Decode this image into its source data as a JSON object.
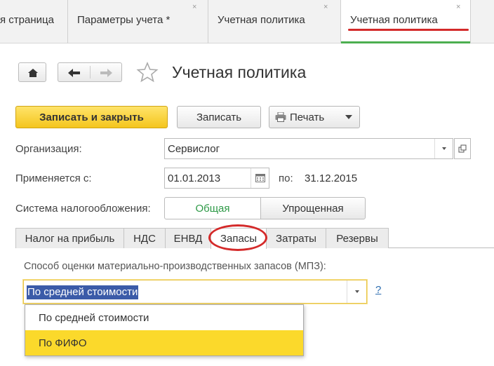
{
  "tabs": [
    {
      "label": "я страница",
      "closable": false
    },
    {
      "label": "Параметры учета *",
      "closable": true
    },
    {
      "label": "Учетная политика",
      "closable": true
    },
    {
      "label": "Учетная политика",
      "closable": true,
      "active": true
    }
  ],
  "close_glyph": "×",
  "page": {
    "title": "Учетная политика"
  },
  "toolbar": {
    "save_close": "Записать и закрыть",
    "save": "Записать",
    "print": "Печать"
  },
  "form": {
    "org_label": "Организация:",
    "org_value": "Сервислог",
    "applies_label": "Применяется с:",
    "applies_value": "01.01.2013",
    "to_label": "по:",
    "to_value": "31.12.2015",
    "tax_label": "Система налогообложения:",
    "tax_options": [
      "Общая",
      "Упрощенная"
    ],
    "tax_selected": "Общая"
  },
  "form_tabs": [
    "Налог на прибыль",
    "НДС",
    "ЕНВД",
    "Запасы",
    "Затраты",
    "Резервы"
  ],
  "active_form_tab": "Запасы",
  "inventory": {
    "method_label": "Способ оценки материально-производственных запасов (МПЗ):",
    "method_value": "По средней стоимости",
    "help": "?",
    "options": [
      "По средней стоимости",
      "По ФИФО"
    ],
    "highlighted": "По ФИФО"
  },
  "colors": {
    "accent_green": "#4caf50",
    "annotation_red": "#d42a2a",
    "primary_yellow": "#f4c51d",
    "highlight_yellow": "#fbd92b",
    "selection_blue": "#3b5ba8"
  }
}
